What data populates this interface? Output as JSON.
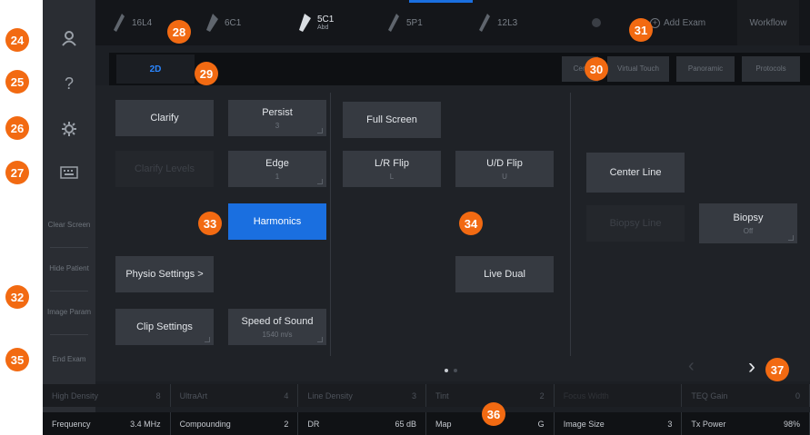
{
  "sidebar": {
    "icons": [
      "user-icon",
      "help-icon",
      "gear-icon",
      "keyboard-icon"
    ],
    "help_glyph": "?",
    "clear_screen": "Clear Screen",
    "hide_patient": "Hide Patient",
    "image_param": "Image Param",
    "end_exam": "End Exam"
  },
  "probes": [
    {
      "label": "16L4",
      "sub": ""
    },
    {
      "label": "6C1",
      "sub": ""
    },
    {
      "label": "5C1",
      "sub": "Abd"
    },
    {
      "label": "5P1",
      "sub": ""
    },
    {
      "label": "12L3",
      "sub": ""
    }
  ],
  "topbar": {
    "add_exam": "Add Exam",
    "workflow": "Workflow"
  },
  "tabs": {
    "active": "2D"
  },
  "modes": {
    "center": "Cen",
    "virtual_touch": "Virtual Touch",
    "panoramic": "Panoramic",
    "protocols": "Protocols"
  },
  "controls": {
    "clarify": "Clarify",
    "persist": "Persist",
    "persist_value": "3",
    "clarify_levels": "Clarify Levels",
    "edge": "Edge",
    "edge_value": "1",
    "harmonics": "Harmonics",
    "physio_settings": "Physio Settings >",
    "clip_settings": "Clip Settings",
    "speed_of_sound": "Speed of Sound",
    "speed_of_sound_value": "1540 m/s",
    "full_screen": "Full Screen",
    "lr_flip": "L/R Flip",
    "lr_flip_value": "L",
    "ud_flip": "U/D Flip",
    "ud_flip_value": "U",
    "live_dual": "Live Dual",
    "center_line": "Center Line",
    "biopsy_line": "Biopsy Line",
    "biopsy": "Biopsy",
    "biopsy_value": "Off"
  },
  "status_row1": [
    {
      "label": "High Density",
      "value": "8"
    },
    {
      "label": "UltraArt",
      "value": "4"
    },
    {
      "label": "Line Density",
      "value": "3"
    },
    {
      "label": "Tint",
      "value": "2"
    },
    {
      "label": "Focus Width",
      "value": ""
    },
    {
      "label": "TEQ Gain",
      "value": "0"
    }
  ],
  "status_row2": [
    {
      "label": "Frequency",
      "value": "3.4 MHz"
    },
    {
      "label": "Compounding",
      "value": "2"
    },
    {
      "label": "DR",
      "value": "65 dB"
    },
    {
      "label": "Map",
      "value": "G"
    },
    {
      "label": "Image Size",
      "value": "3"
    },
    {
      "label": "Tx Power",
      "value": "98%"
    }
  ],
  "nav": {
    "next_glyph": "›"
  },
  "callouts": [
    "24",
    "25",
    "26",
    "27",
    "28",
    "29",
    "30",
    "31",
    "32",
    "33",
    "34",
    "35",
    "36",
    "37"
  ],
  "colors": {
    "accent": "#1a6fe0",
    "callout": "#f26a12",
    "background": "#1c1f24"
  }
}
